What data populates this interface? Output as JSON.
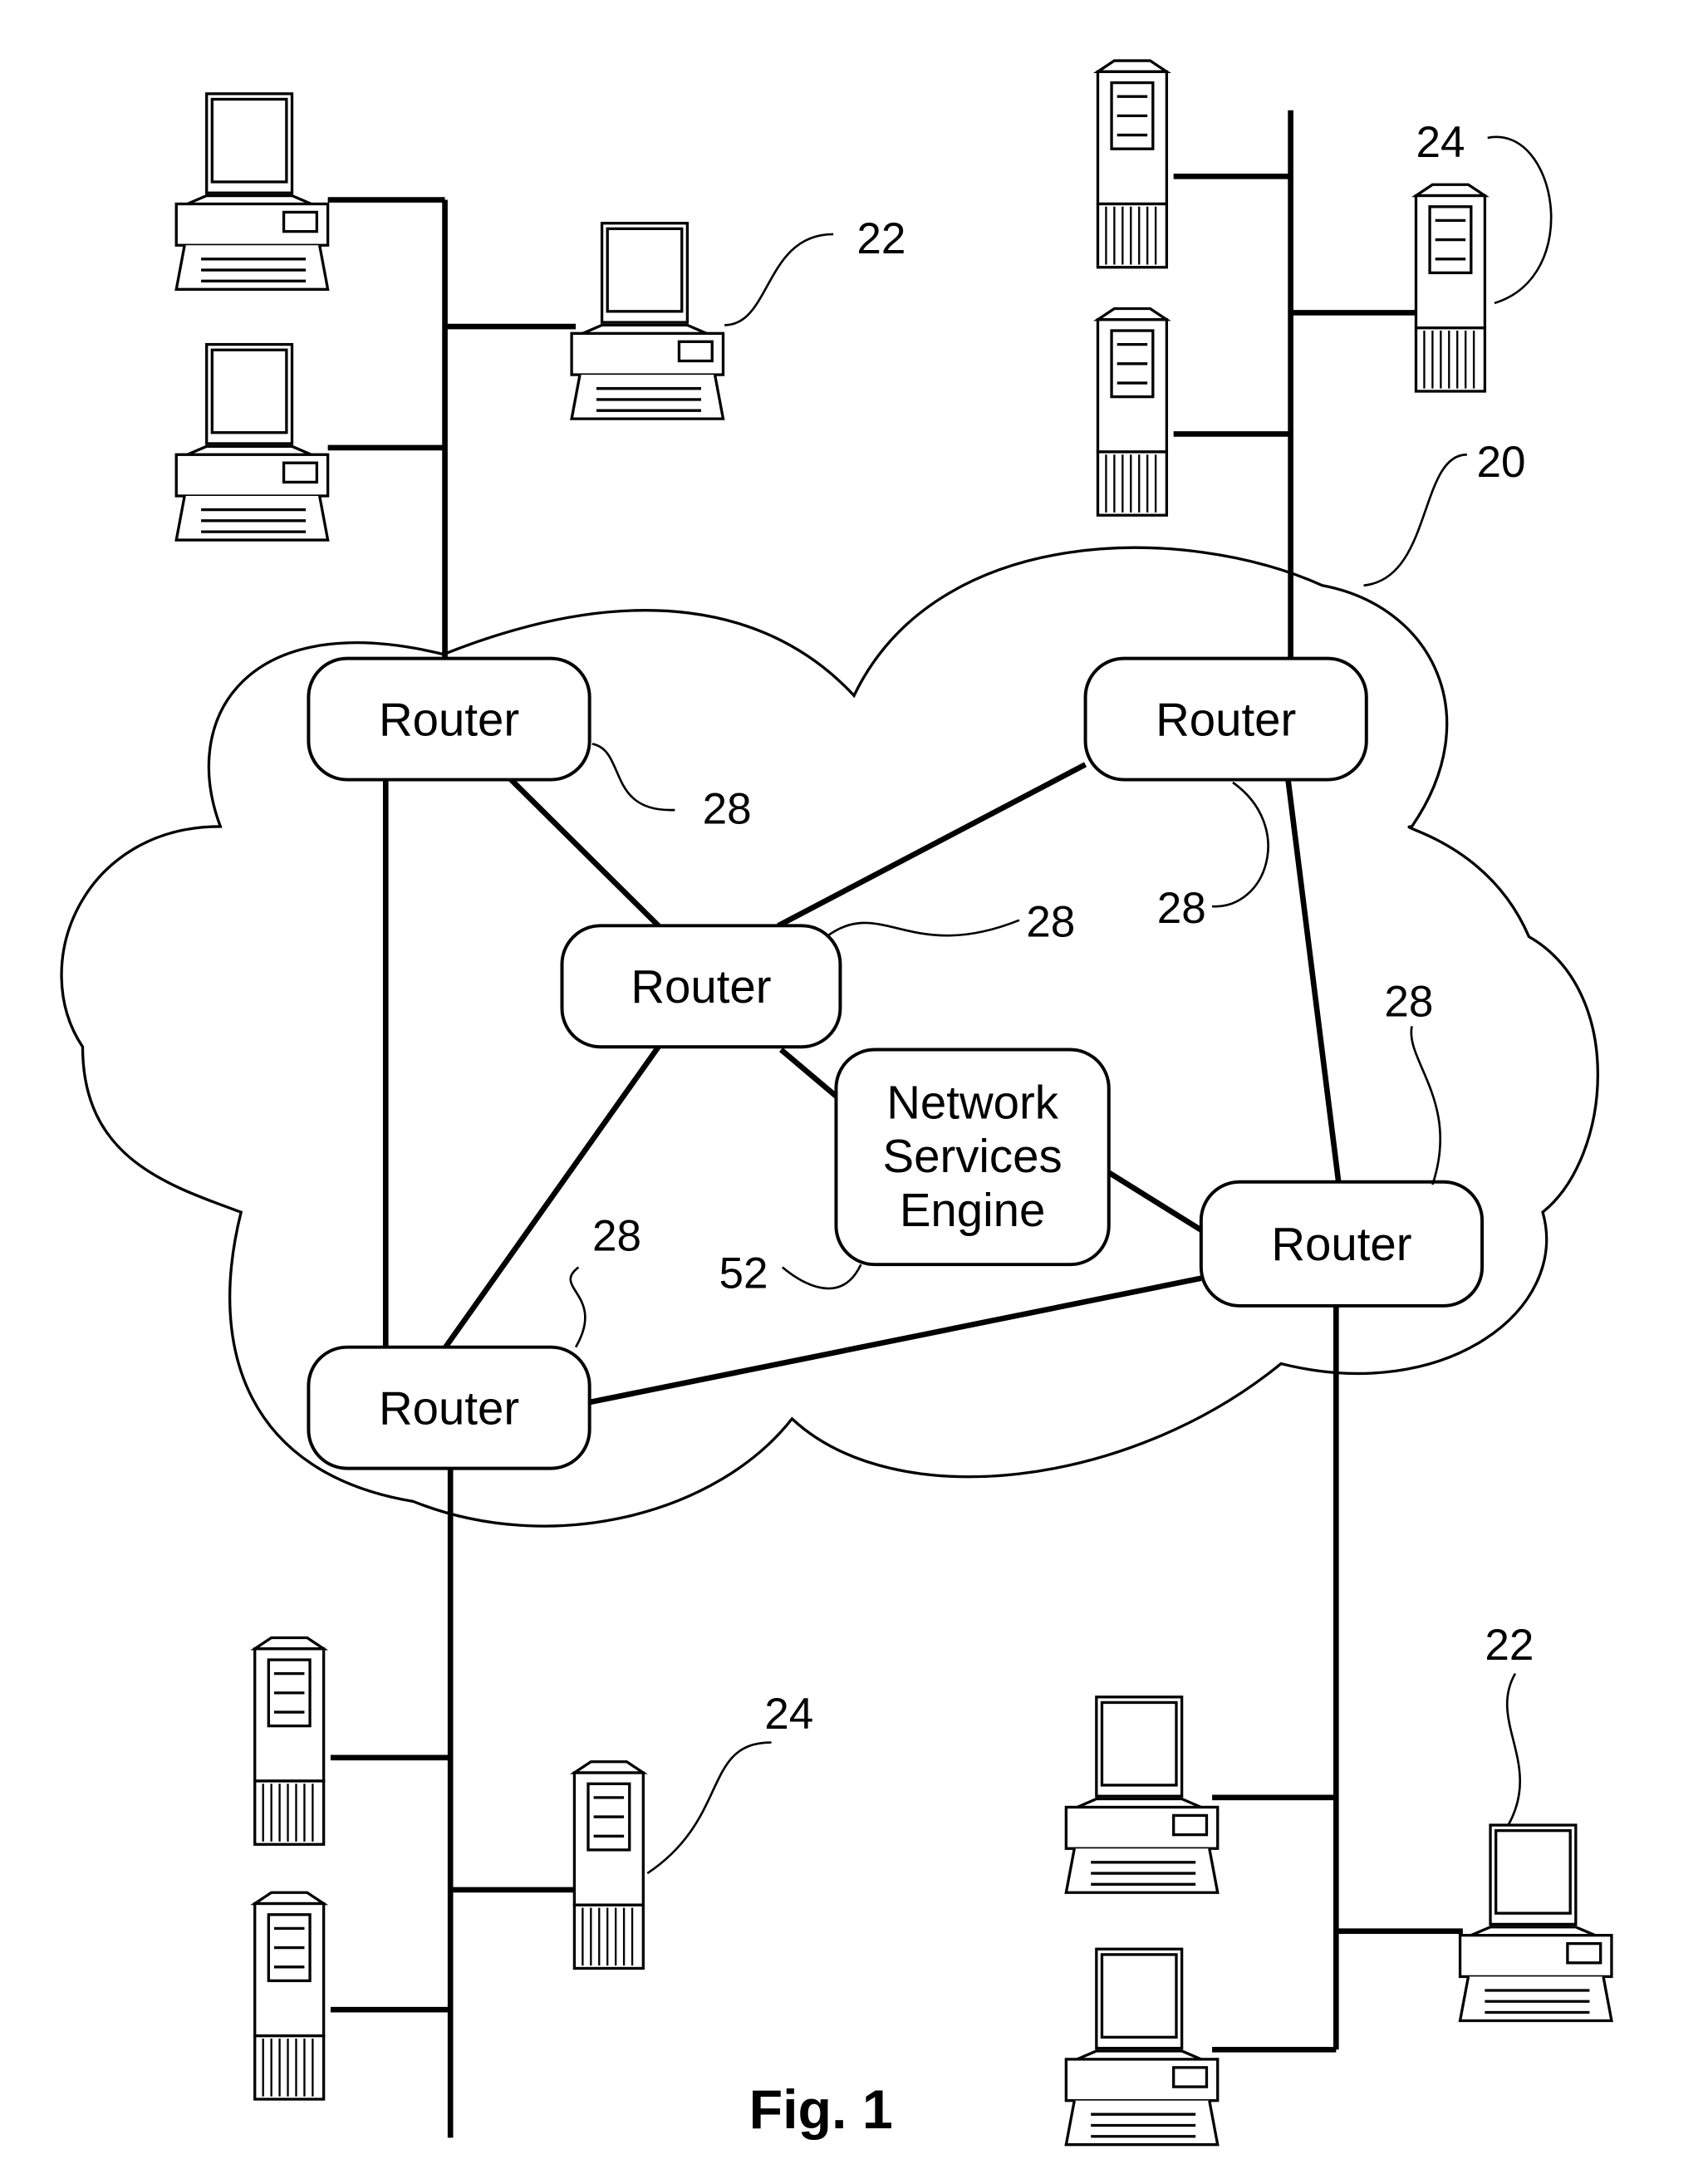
{
  "figure": {
    "caption": "Fig. 1",
    "network_ref": "20",
    "routers": [
      {
        "id": "router-top-left",
        "label": "Router",
        "ref": "28"
      },
      {
        "id": "router-top-right",
        "label": "Router",
        "ref": "28"
      },
      {
        "id": "router-center",
        "label": "Router",
        "ref": "28"
      },
      {
        "id": "router-right",
        "label": "Router",
        "ref": "28"
      },
      {
        "id": "router-bottom-left",
        "label": "Router",
        "ref": "28"
      }
    ],
    "engine": {
      "lines": [
        "Network",
        "Services",
        "Engine"
      ],
      "ref": "52"
    },
    "client_ref_top": "22",
    "client_ref_bottom": "22",
    "server_ref_top": "24",
    "server_ref_bottom": "24"
  }
}
